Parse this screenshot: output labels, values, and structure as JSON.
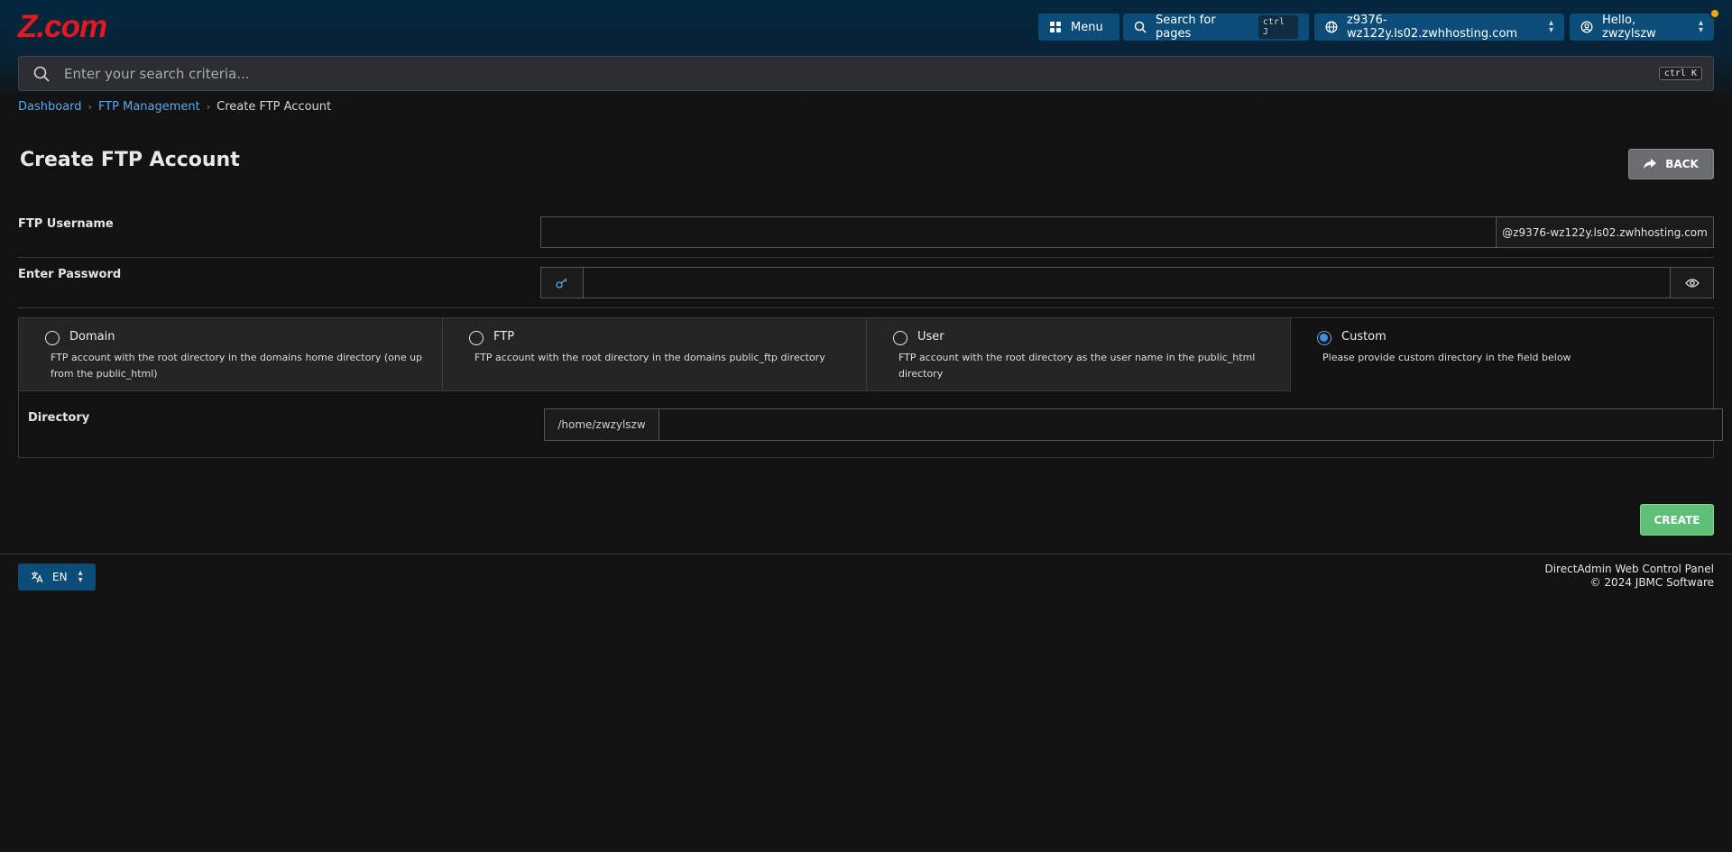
{
  "brand": {
    "logo_text": "Z.com",
    "logo_color": "#e11a22"
  },
  "topbar": {
    "menu_label": "Menu",
    "search_pages_label": "Search for pages",
    "search_pages_shortcut": "ctrl J",
    "domain_label": "z9376-wz122y.ls02.zwhhosting.com",
    "user_label": "Hello, zwzylszw"
  },
  "search": {
    "placeholder": "Enter your search criteria...",
    "shortcut": "ctrl K"
  },
  "breadcrumb": {
    "items": [
      "Dashboard",
      "FTP Management"
    ],
    "current": "Create FTP Account"
  },
  "page": {
    "title": "Create FTP Account",
    "back_label": "BACK"
  },
  "form": {
    "username_label": "FTP Username",
    "username_value": "",
    "username_suffix": "@z9376-wz122y.ls02.zwhhosting.com",
    "password_label": "Enter Password",
    "password_value": "",
    "options": [
      {
        "title": "Domain",
        "desc": "FTP account with the root directory in the domains home directory (one up from the public_html)",
        "selected": false
      },
      {
        "title": "FTP",
        "desc": "FTP account with the root directory in the domains public_ftp directory",
        "selected": false
      },
      {
        "title": "User",
        "desc": "FTP account with the root directory as the user name in the public_html directory",
        "selected": false
      },
      {
        "title": "Custom",
        "desc": "Please provide custom directory in the field below",
        "selected": true
      }
    ],
    "directory_label": "Directory",
    "directory_prefix": "/home/zwzylszw",
    "directory_value": "",
    "create_label": "CREATE"
  },
  "footer": {
    "language": "EN",
    "line1": "DirectAdmin Web Control Panel",
    "line2": "© 2024 JBMC Software"
  },
  "colors": {
    "accent": "#0b4d78",
    "link": "#5aa9e6",
    "success": "#5fbf77",
    "notification": "#f0a90a"
  }
}
